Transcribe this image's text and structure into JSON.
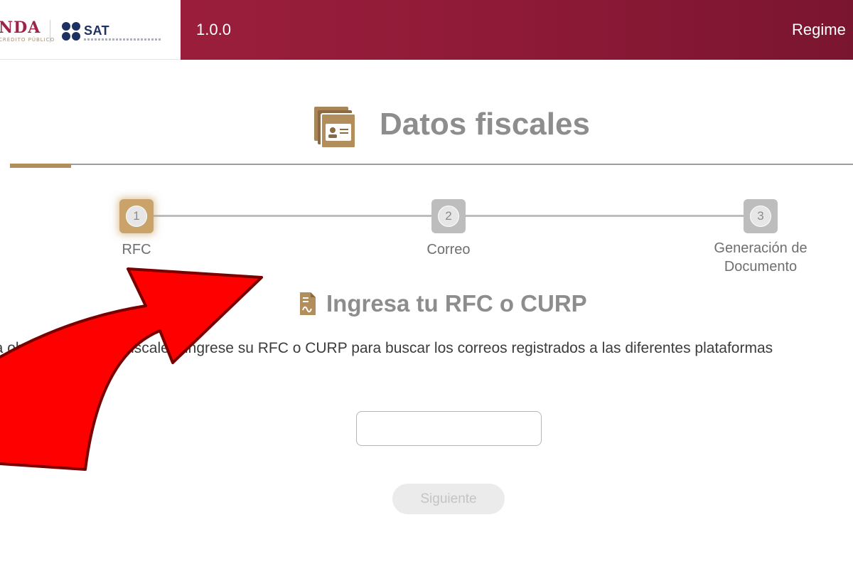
{
  "header": {
    "logo_left_text": "NDA",
    "logo_left_subtext": "CRÉDITO PÚBLICO",
    "logo_right_text": "SAT",
    "logo_right_icon": "sat-dots-icon",
    "version": "1.0.0",
    "right_menu_label": "Regime",
    "brand_color": "#9d2449",
    "accent_color": "#b38e5d"
  },
  "page": {
    "title": "Datos fiscales",
    "title_icon": "id-card-icon"
  },
  "stepper": {
    "current_step": 1,
    "steps": [
      {
        "number": "1",
        "label": "RFC",
        "state": "active"
      },
      {
        "number": "2",
        "label": "Correo",
        "state": "inactive"
      },
      {
        "number": "3",
        "label": "Generación de Documento",
        "state": "inactive"
      }
    ]
  },
  "form": {
    "section_icon": "document-icon",
    "section_title": "Ingresa tu RFC o CURP",
    "instructions": "Para obtener tus datos fiscales, ingrese su RFC o CURP para buscar los correos registrados a las diferentes plataformas",
    "rfc_value": "",
    "rfc_placeholder": "",
    "next_label": "Siguiente",
    "next_disabled": true
  },
  "overlay": {
    "arrow_icon": "red-curved-arrow-icon",
    "arrow_color": "#ff0000"
  }
}
